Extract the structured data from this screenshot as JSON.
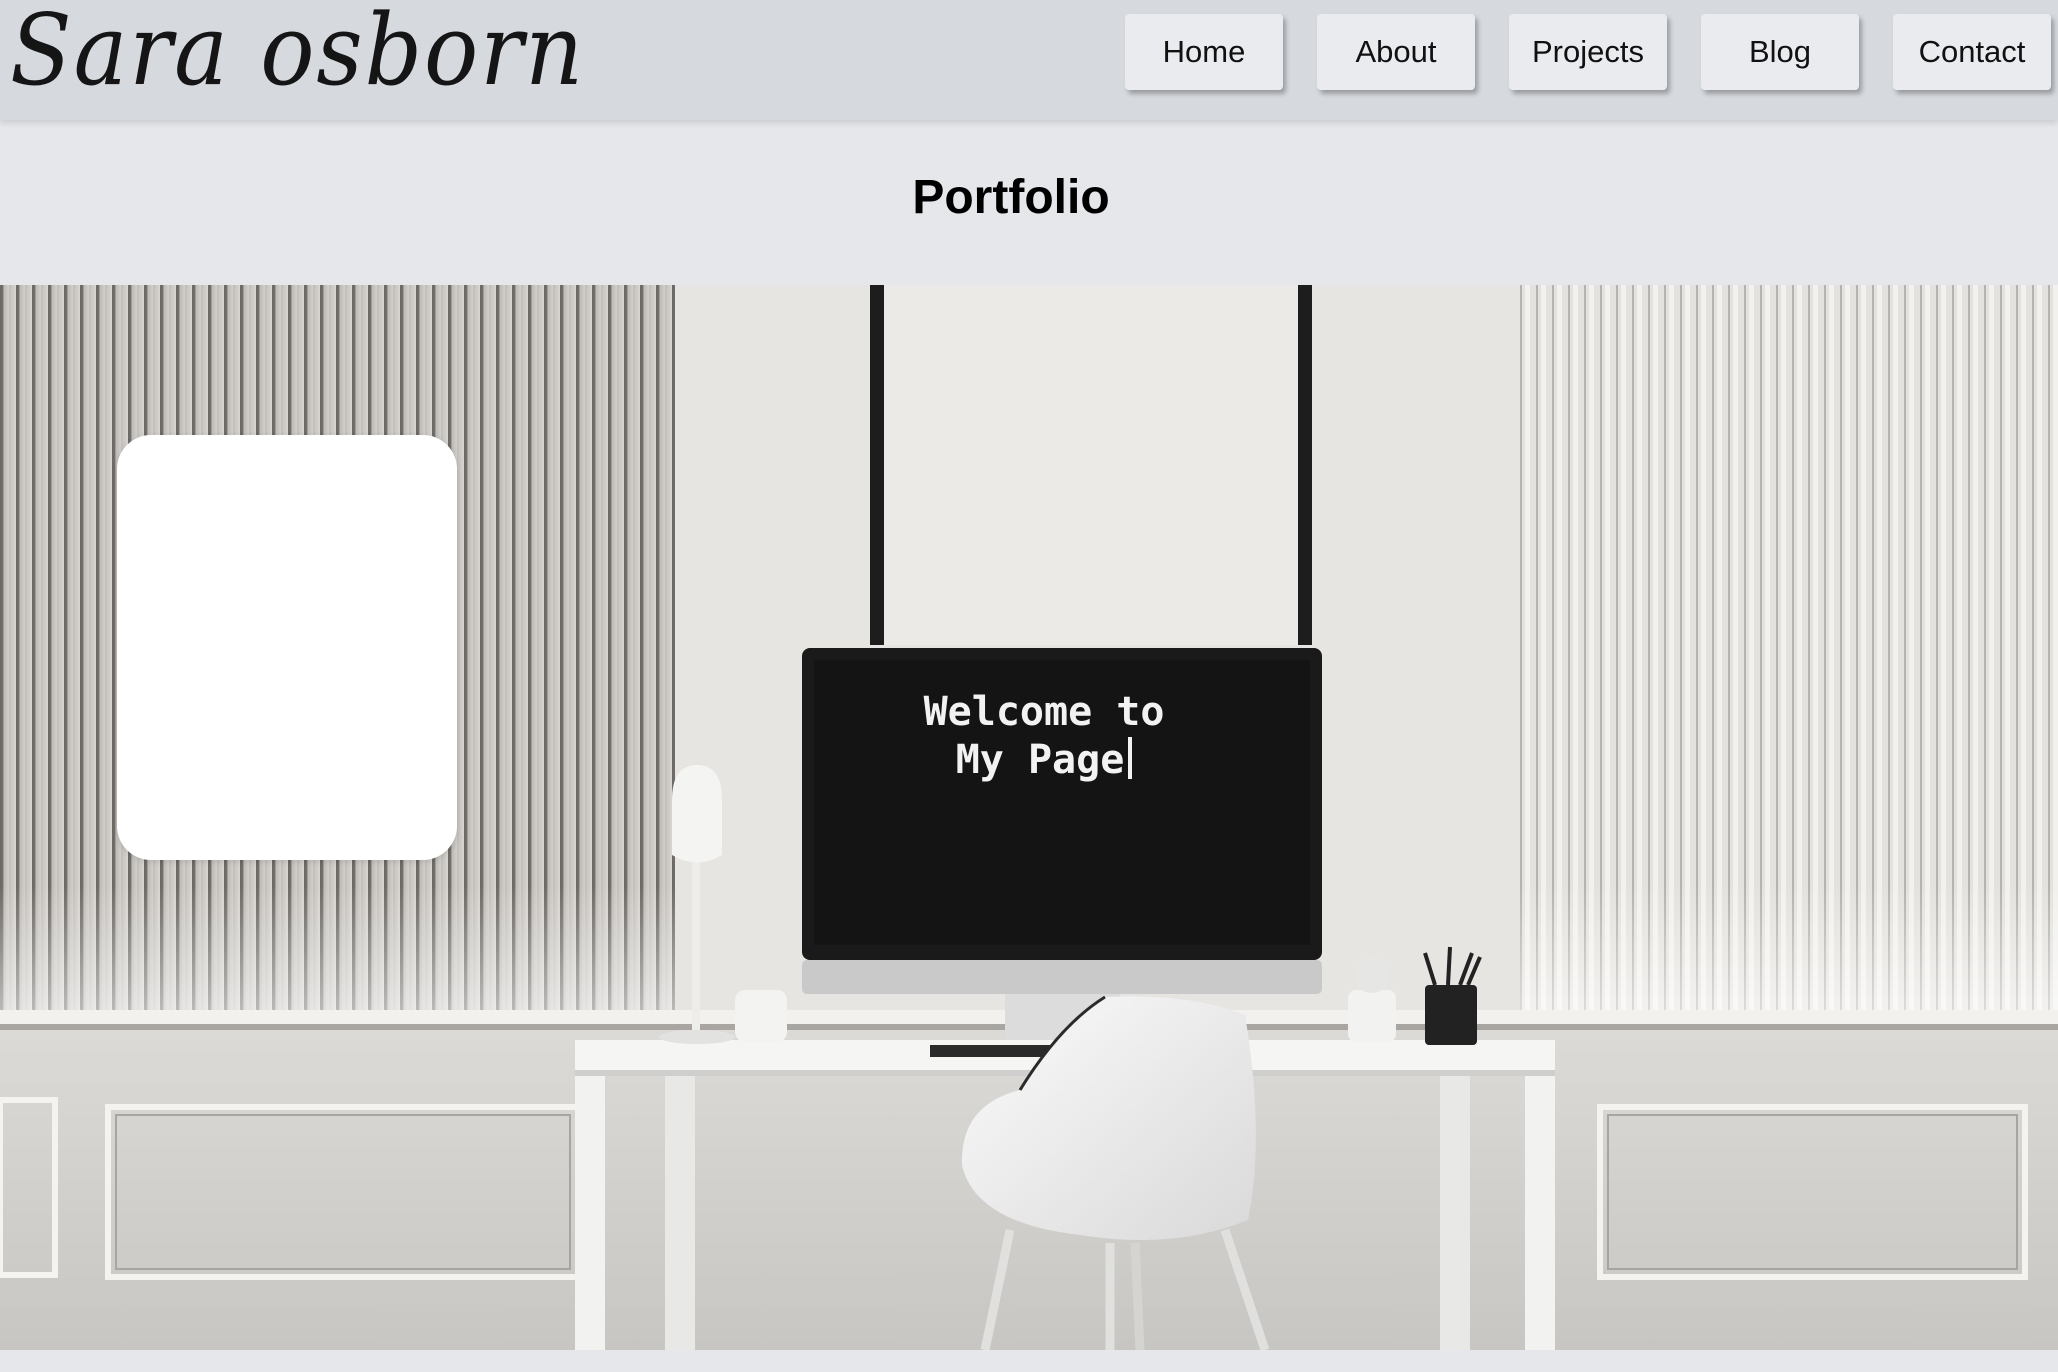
{
  "header": {
    "logo_text": "Sara osborn",
    "nav": [
      {
        "label": "Home"
      },
      {
        "label": "About"
      },
      {
        "label": "Projects"
      },
      {
        "label": "Blog"
      },
      {
        "label": "Contact"
      }
    ]
  },
  "main": {
    "title": "Portfolio",
    "hero": {
      "screen_text": "Welcome to\nMy Page"
    }
  },
  "colors": {
    "header_bg": "#d6d9de",
    "page_bg": "#e5e7eb",
    "button_bg": "#eaebee",
    "screen_bg": "#141414"
  }
}
